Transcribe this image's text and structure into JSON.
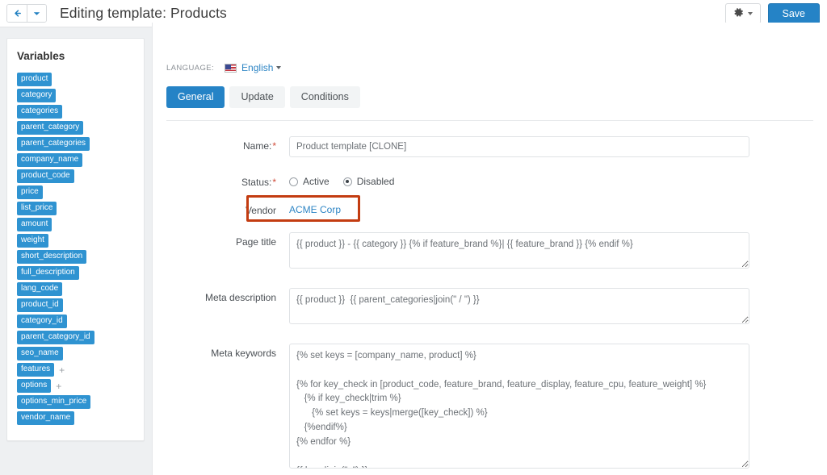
{
  "topbar": {
    "back_icon": "arrow-left-icon",
    "dropdown_icon": "caret-down-icon",
    "title": "Editing template: Products",
    "gear_icon": "gear-icon",
    "save_label": "Save"
  },
  "sidebar": {
    "heading": "Variables",
    "variables": [
      {
        "label": "product",
        "has_plus": false
      },
      {
        "label": "category",
        "has_plus": false
      },
      {
        "label": "categories",
        "has_plus": false
      },
      {
        "label": "parent_category",
        "has_plus": false
      },
      {
        "label": "parent_categories",
        "has_plus": false
      },
      {
        "label": "company_name",
        "has_plus": false
      },
      {
        "label": "product_code",
        "has_plus": false
      },
      {
        "label": "price",
        "has_plus": false
      },
      {
        "label": "list_price",
        "has_plus": false
      },
      {
        "label": "amount",
        "has_plus": false
      },
      {
        "label": "weight",
        "has_plus": false
      },
      {
        "label": "short_description",
        "has_plus": false
      },
      {
        "label": "full_description",
        "has_plus": false
      },
      {
        "label": "lang_code",
        "has_plus": false
      },
      {
        "label": "product_id",
        "has_plus": false
      },
      {
        "label": "category_id",
        "has_plus": false
      },
      {
        "label": "parent_category_id",
        "has_plus": false
      },
      {
        "label": "seo_name",
        "has_plus": false
      },
      {
        "label": "features",
        "has_plus": true
      },
      {
        "label": "options",
        "has_plus": true
      },
      {
        "label": "options_min_price",
        "has_plus": false
      },
      {
        "label": "vendor_name",
        "has_plus": false
      }
    ],
    "plus_glyph": "+"
  },
  "main": {
    "language": {
      "label": "LANGUAGE:",
      "flag_icon": "us-flag-icon",
      "value": "English",
      "caret_icon": "caret-down-icon"
    },
    "tabs": [
      {
        "label": "General",
        "active": true
      },
      {
        "label": "Update",
        "active": false
      },
      {
        "label": "Conditions",
        "active": false
      }
    ],
    "fields": {
      "name": {
        "label": "Name:",
        "required": true,
        "value": "Product template [CLONE]"
      },
      "status": {
        "label": "Status:",
        "required": true,
        "options": [
          {
            "label": "Active",
            "selected": false
          },
          {
            "label": "Disabled",
            "selected": true
          }
        ]
      },
      "vendor": {
        "label": "Vendor",
        "required": false,
        "value": "ACME Corp",
        "highlight_color": "#c33c11"
      },
      "page_title": {
        "label": "Page title",
        "required": false,
        "value": "{{ product }} - {{ category }} {% if feature_brand %}| {{ feature_brand }} {% endif %}"
      },
      "meta_description": {
        "label": "Meta description",
        "required": false,
        "value": "{{ product }}  {{ parent_categories|join(\" / \") }}"
      },
      "meta_keywords": {
        "label": "Meta keywords",
        "required": false,
        "value": "{% set keys = [company_name, product] %}\n\n{% for key_check in [product_code, feature_brand, feature_display, feature_cpu, feature_weight] %}\n   {% if key_check|trim %}\n      {% set keys = keys|merge([key_check]) %}\n   {%endif%}\n{% endfor %}\n\n{{ keys|join(\", \") }}"
      }
    }
  },
  "colors": {
    "accent": "#2583c6",
    "tag": "#2f93d1",
    "link": "#2f86c5",
    "highlight": "#c33c11",
    "page_bg": "#eef0f2"
  }
}
